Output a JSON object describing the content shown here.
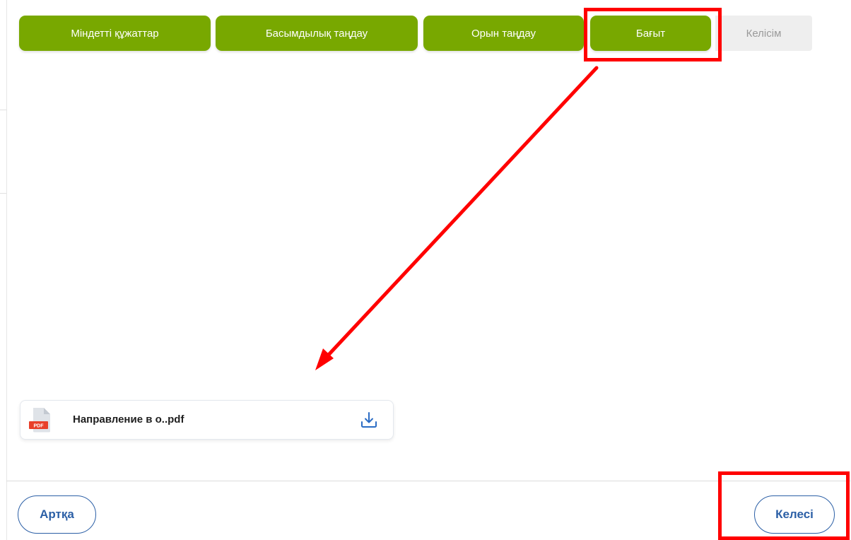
{
  "steps": [
    {
      "label": "Міндетті құжаттар",
      "state": "done"
    },
    {
      "label": "Басымдылық таңдау",
      "state": "done"
    },
    {
      "label": "Орын таңдау",
      "state": "done"
    },
    {
      "label": "Бағыт",
      "state": "active"
    },
    {
      "label": "Келісім",
      "state": "inactive"
    }
  ],
  "file": {
    "name": "Направление в о..pdf",
    "badge": "PDF",
    "icon": "pdf-file-icon",
    "action_icon": "download-icon"
  },
  "footer": {
    "back_label": "Артқа",
    "next_label": "Келесі"
  },
  "colors": {
    "step_active": "#78a800",
    "step_inactive": "#eeeeee",
    "accent": "#2b5fa6",
    "annotation": "#ff0000"
  }
}
